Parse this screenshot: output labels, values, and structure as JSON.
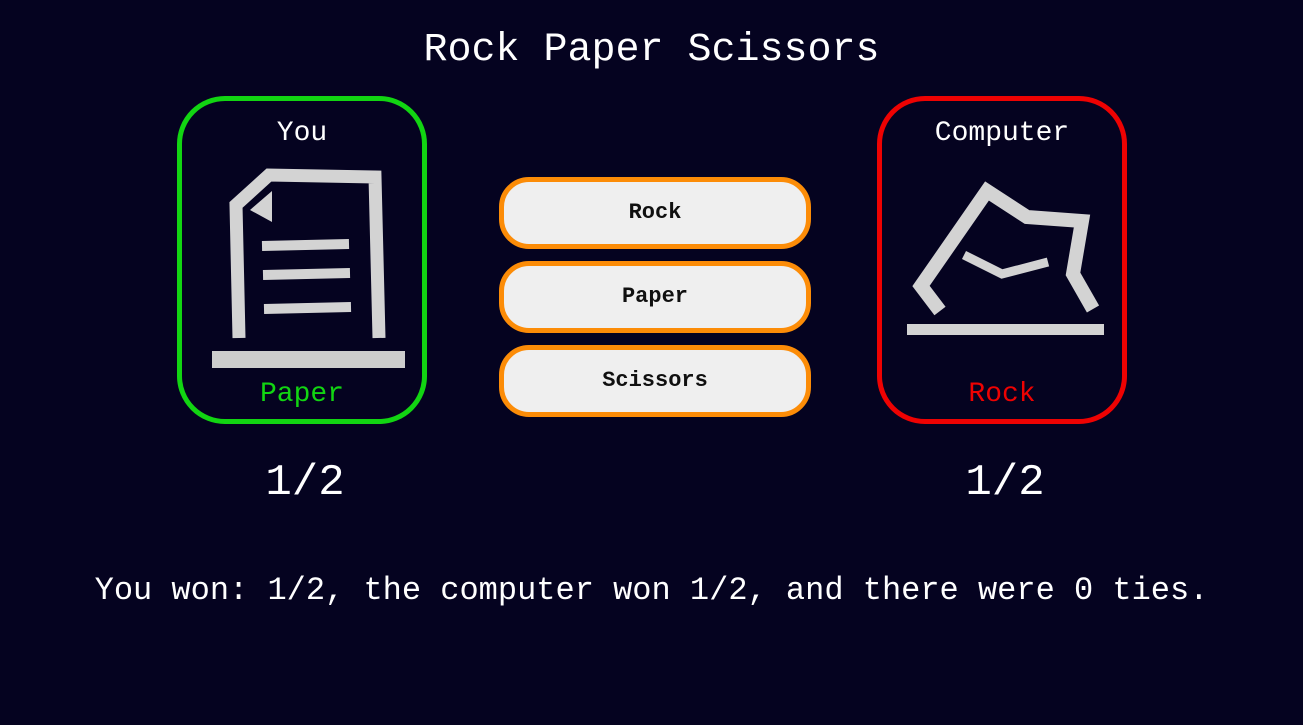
{
  "app": {
    "title": "Rock Paper Scissors"
  },
  "player": {
    "label": "You",
    "choice": "Paper",
    "icon": "paper-icon",
    "score": "1/2",
    "accent": "#12d512"
  },
  "computer": {
    "label": "Computer",
    "choice": "Rock",
    "icon": "rock-icon",
    "score": "1/2",
    "accent": "#ee0202"
  },
  "buttons": {
    "rock_label": "Rock",
    "paper_label": "Paper",
    "scissors_label": "Scissors",
    "border_color": "#fc8c07"
  },
  "result": {
    "text": "You won: 1/2, the computer won 1/2, and there were 0 ties."
  }
}
